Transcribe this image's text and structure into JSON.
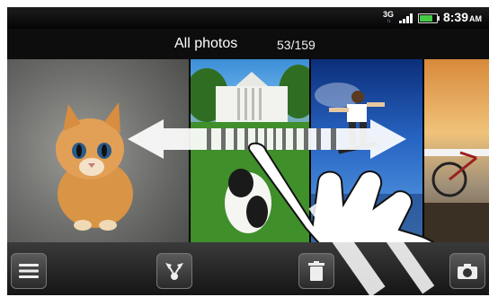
{
  "status_bar": {
    "network_type": "3G",
    "battery_level": 0.8,
    "time": "8:39",
    "ampm": "AM"
  },
  "header": {
    "album_title": "All photos",
    "photo_count": "53/159"
  },
  "photos": [
    {
      "subject": "kitten"
    },
    {
      "subject": "white house with dog"
    },
    {
      "subject": "skateboarder jumping"
    },
    {
      "subject": "bicycle at sunset"
    }
  ],
  "toolbar": {
    "buttons": [
      {
        "icon": "menu-icon"
      },
      {
        "icon": "share-icon"
      },
      {
        "icon": "delete-icon"
      },
      {
        "icon": "camera-icon"
      }
    ]
  },
  "colors": {
    "battery": "#44cc44",
    "background": "#000000"
  }
}
